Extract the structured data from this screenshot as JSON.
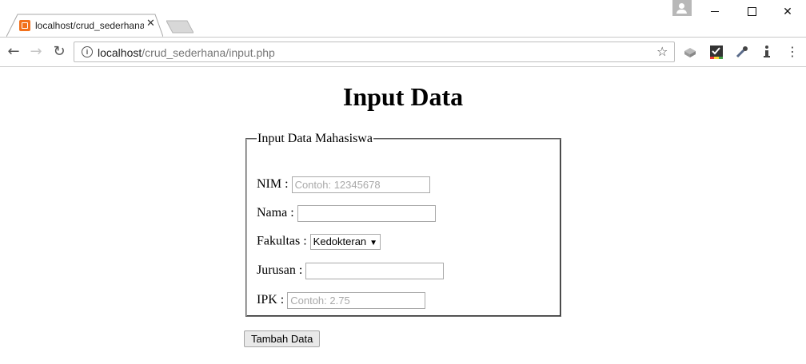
{
  "browser": {
    "tab_title": "localhost/crud_sederhana",
    "tab_close": "✕",
    "url_host": "localhost",
    "url_path": "/crud_sederhana/input.php"
  },
  "page": {
    "title": "Input Data",
    "legend": "Input Data Mahasiswa",
    "fields": {
      "nim": {
        "label": "NIM :",
        "value": "",
        "placeholder": "Contoh: 12345678"
      },
      "nama": {
        "label": "Nama :",
        "value": "",
        "placeholder": ""
      },
      "fakultas": {
        "label": "Fakultas :",
        "selected": "Kedokteran"
      },
      "jurusan": {
        "label": "Jurusan :",
        "value": "",
        "placeholder": ""
      },
      "ipk": {
        "label": "IPK :",
        "value": "",
        "placeholder": "Contoh: 2.75"
      }
    },
    "submit_label": "Tambah Data"
  }
}
